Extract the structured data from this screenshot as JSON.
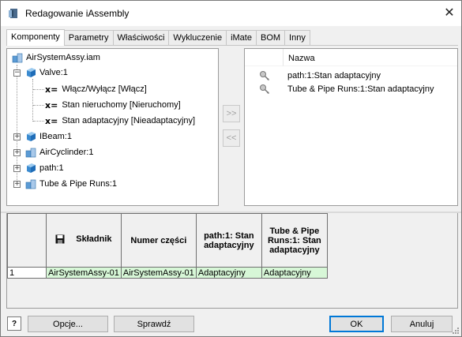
{
  "window": {
    "title": "Redagowanie iAssembly",
    "close_glyph": "✕"
  },
  "tabs": [
    {
      "label": "Komponenty",
      "active": true
    },
    {
      "label": "Parametry"
    },
    {
      "label": "Właściwości"
    },
    {
      "label": "Wykluczenie"
    },
    {
      "label": "iMate"
    },
    {
      "label": "BOM"
    },
    {
      "label": "Inny"
    }
  ],
  "tree": {
    "root": {
      "label": "AirSystemAssy.iam",
      "icon": "assembly-icon"
    },
    "valve": {
      "label": "Valve:1",
      "icon": "part-icon",
      "expander": "−",
      "children": [
        {
          "prefix": "x=",
          "label": "Włącz/Wyłącz [Włącz]"
        },
        {
          "prefix": "x=",
          "label": "Stan nieruchomy [Nieruchomy]"
        },
        {
          "prefix": "x=",
          "label": "Stan adaptacyjny [Nieadaptacyjny]"
        }
      ]
    },
    "items": [
      {
        "label": "IBeam:1",
        "icon": "part-icon",
        "expander": "+"
      },
      {
        "label": "AirCyclinder:1",
        "icon": "assembly-icon",
        "expander": "+"
      },
      {
        "label": "path:1",
        "icon": "part-icon",
        "expander": "+"
      },
      {
        "label": "Tube & Pipe Runs:1",
        "icon": "assembly-icon",
        "expander": "+"
      }
    ]
  },
  "move": {
    "add_label": ">>",
    "remove_label": "<<"
  },
  "selected": {
    "header": "Nazwa",
    "rows": [
      {
        "icon": "key-icon",
        "label": "path:1:Stan adaptacyjny"
      },
      {
        "icon": "key-icon",
        "label": "Tube & Pipe Runs:1:Stan adaptacyjny"
      }
    ]
  },
  "table": {
    "columns": [
      {
        "label": "Składnik",
        "icon": "save-icon"
      },
      {
        "label": "Numer części"
      },
      {
        "label": "path:1: Stan adaptacyjny"
      },
      {
        "label": "Tube & Pipe Runs:1: Stan adaptacyjny"
      }
    ],
    "rows": [
      {
        "index": "1",
        "cells": [
          "AirSystemAssy-01",
          "AirSystemAssy-01",
          "Adaptacyjny",
          "Adaptacyjny"
        ]
      }
    ]
  },
  "buttons": {
    "help": "?",
    "options": "Opcje...",
    "check": "Sprawdź",
    "ok": "OK",
    "cancel": "Anuluj"
  }
}
